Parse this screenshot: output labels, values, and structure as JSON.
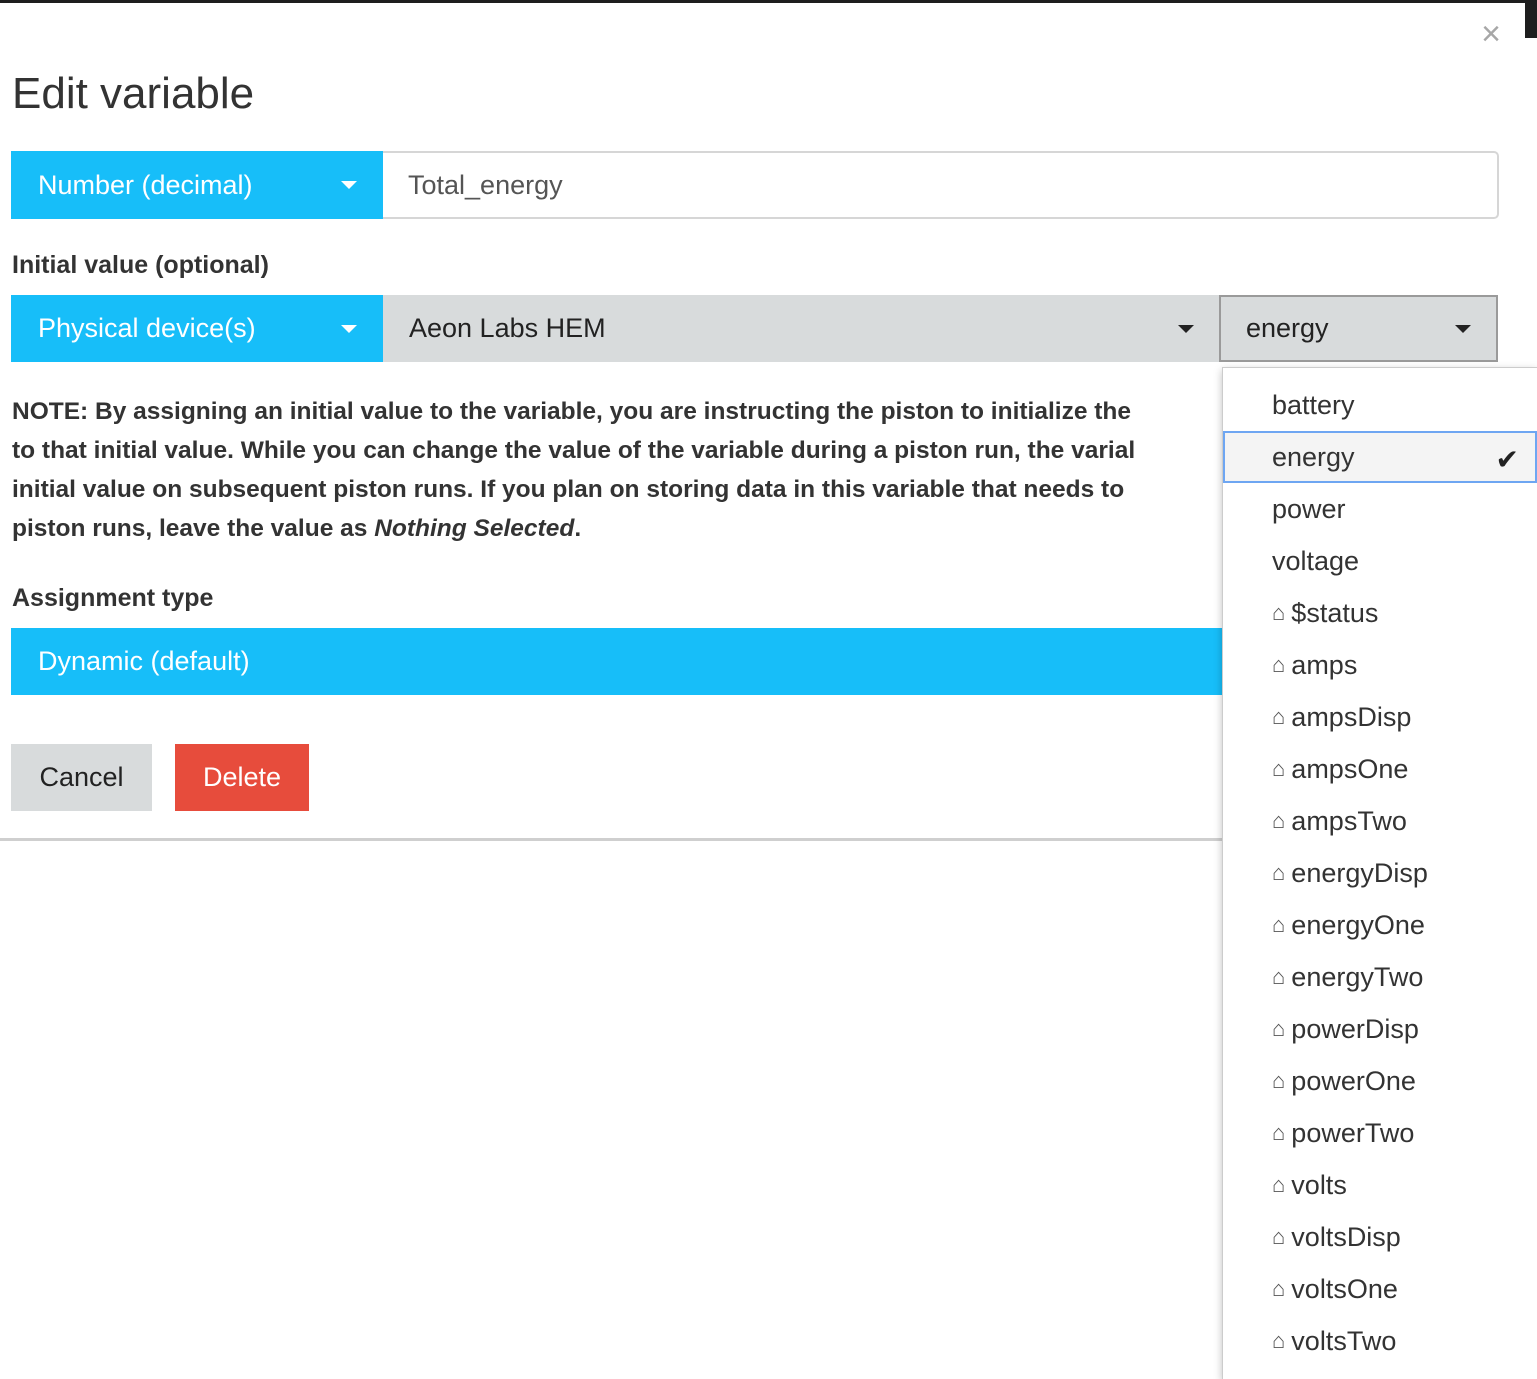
{
  "modal": {
    "title": "Edit variable",
    "close_symbol": "×"
  },
  "variable": {
    "type_label": "Number (decimal)",
    "name_value": "Total_energy"
  },
  "initial_value": {
    "label": "Initial value (optional)",
    "source_label": "Physical device(s)",
    "device_label": "Aeon Labs HEM",
    "attribute_label": "energy"
  },
  "note": {
    "prefix": "NOTE:",
    "line1": "By assigning an initial value to the variable, you are instructing the piston to initialize the",
    "line2": "to that initial value. While you can change the value of the variable during a piston run, the varial",
    "line3": "initial value on subsequent piston runs. If you plan on storing data in this variable that needs to",
    "line4_start": "piston runs, leave the value as ",
    "line4_em": "Nothing Selected",
    "line4_end": "."
  },
  "assignment": {
    "label": "Assignment type",
    "value": "Dynamic (default)"
  },
  "buttons": {
    "cancel": "Cancel",
    "delete": "Delete"
  },
  "dropdown": {
    "selected": "energy",
    "check_symbol": "✔",
    "attr_icon_symbol": "⌂",
    "items": [
      {
        "label": "battery",
        "custom": false
      },
      {
        "label": "energy",
        "custom": false
      },
      {
        "label": "power",
        "custom": false
      },
      {
        "label": "voltage",
        "custom": false
      },
      {
        "label": "$status",
        "custom": true
      },
      {
        "label": "amps",
        "custom": true
      },
      {
        "label": "ampsDisp",
        "custom": true
      },
      {
        "label": "ampsOne",
        "custom": true
      },
      {
        "label": "ampsTwo",
        "custom": true
      },
      {
        "label": "energyDisp",
        "custom": true
      },
      {
        "label": "energyOne",
        "custom": true
      },
      {
        "label": "energyTwo",
        "custom": true
      },
      {
        "label": "powerDisp",
        "custom": true
      },
      {
        "label": "powerOne",
        "custom": true
      },
      {
        "label": "powerTwo",
        "custom": true
      },
      {
        "label": "volts",
        "custom": true
      },
      {
        "label": "voltsDisp",
        "custom": true
      },
      {
        "label": "voltsOne",
        "custom": true
      },
      {
        "label": "voltsTwo",
        "custom": true
      }
    ]
  },
  "colors": {
    "primary": "#17bef9",
    "danger": "#e74c3c",
    "neutral": "#d8dbdc"
  }
}
